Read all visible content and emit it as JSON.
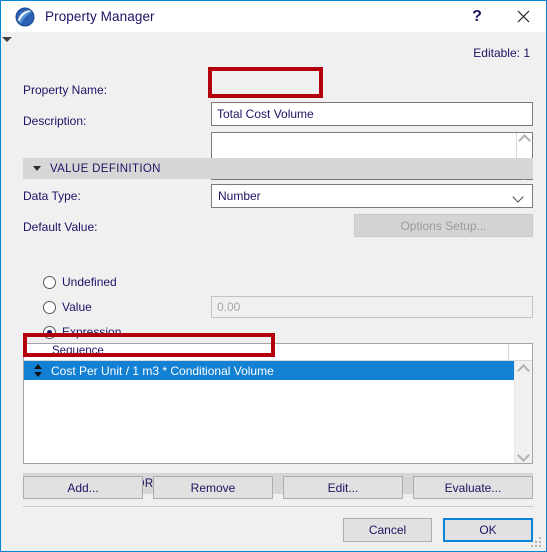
{
  "window": {
    "title": "Property Manager",
    "app_icon": "archicad-logo-icon",
    "help_label": "?",
    "close_label": "✕",
    "accent_color": "#0a84d8",
    "annotation_color": "#b3000c"
  },
  "header": {
    "editable_label": "Editable:",
    "editable_count": "1"
  },
  "fields": {
    "property_name_label": "Property Name:",
    "property_name_value": "Total Cost Volume",
    "description_label": "Description:",
    "description_value": "",
    "description_placeholder": ""
  },
  "value_definition": {
    "section_label": "VALUE DEFINITION",
    "expanded": true,
    "data_type_label": "Data Type:",
    "data_type_value": "Number",
    "data_type_options": [
      "Number"
    ],
    "default_value_label": "Default Value:",
    "options_setup_label": "Options Setup...",
    "options_setup_enabled": false,
    "radios": [
      {
        "id": "undefined",
        "label": "Undefined",
        "checked": false
      },
      {
        "id": "value",
        "label": "Value",
        "checked": false
      },
      {
        "id": "expression",
        "label": "Expression",
        "checked": true
      }
    ],
    "value_input_placeholder": "0.00",
    "value_input_enabled": false
  },
  "sequence_list": {
    "column_header": "Sequence",
    "rows": [
      {
        "text": "Cost Per Unit / 1 m3 * Conditional Volume",
        "selected": true,
        "handle_icon": "drag-updown-icon"
      }
    ],
    "selected_row_color": "#1281d4",
    "scroll_up_icon": "chevron-up-icon",
    "scroll_down_icon": "chevron-down-icon"
  },
  "list_actions": [
    {
      "id": "add",
      "label": "Add..."
    },
    {
      "id": "remove",
      "label": "Remove"
    },
    {
      "id": "edit",
      "label": "Edit..."
    },
    {
      "id": "evaluate",
      "label": "Evaluate..."
    }
  ],
  "availability": {
    "section_label": "AVAILABILITY FOR CLASSIFICATIONS",
    "expanded": false
  },
  "footer": {
    "cancel_label": "Cancel",
    "ok_label": "OK",
    "ok_focused": true
  }
}
